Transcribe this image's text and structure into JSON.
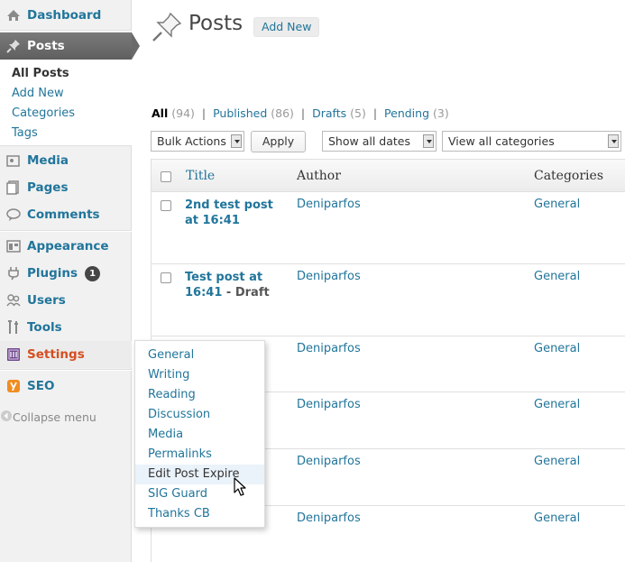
{
  "sidebar": {
    "dashboard": "Dashboard",
    "posts": "Posts",
    "posts_submenu": [
      "All Posts",
      "Add New",
      "Categories",
      "Tags"
    ],
    "media": "Media",
    "pages": "Pages",
    "comments": "Comments",
    "appearance": "Appearance",
    "plugins": "Plugins",
    "plugins_badge": "1",
    "users": "Users",
    "tools": "Tools",
    "settings": "Settings",
    "seo": "SEO",
    "collapse": "Collapse menu"
  },
  "settings_flyout": {
    "items": [
      "General",
      "Writing",
      "Reading",
      "Discussion",
      "Media",
      "Permalinks",
      "Edit Post Expire",
      "SIG Guard",
      "Thanks CB"
    ],
    "hovered": "Edit Post Expire"
  },
  "header": {
    "title": "Posts",
    "add_new": "Add New"
  },
  "filters": {
    "all_label": "All",
    "all_count": "(94)",
    "published_label": "Published",
    "published_count": "(86)",
    "drafts_label": "Drafts",
    "drafts_count": "(5)",
    "pending_label": "Pending",
    "pending_count": "(3)",
    "separator": "|"
  },
  "toolbar": {
    "bulk_actions": "Bulk Actions",
    "apply": "Apply",
    "dates": "Show all dates",
    "categories": "View all categories"
  },
  "table": {
    "columns": {
      "title": "Title",
      "author": "Author",
      "categories": "Categories"
    },
    "rows": [
      {
        "title": "2nd test post at 16:41",
        "state": "",
        "author": "Deniparfos",
        "category": "General"
      },
      {
        "title": "Test post at 16:41",
        "state": " - Draft",
        "author": "Deniparfos",
        "category": "General"
      },
      {
        "title": "",
        "state": "",
        "author": "Deniparfos",
        "category": "General"
      },
      {
        "title": "",
        "state": "",
        "author": "Deniparfos",
        "category": "General"
      },
      {
        "title": "",
        "state": "",
        "author": "Deniparfos",
        "category": "General"
      },
      {
        "title": "",
        "state": "",
        "author": "Deniparfos",
        "category": "General"
      }
    ]
  },
  "colors": {
    "link": "#21759b",
    "active_menu": "#6a6a6a",
    "settings_text": "#d54e21",
    "sidebar_bg": "#f1f1f1"
  },
  "icons": [
    "dashboard-icon",
    "pushpin-icon",
    "media-icon",
    "pages-icon",
    "comments-icon",
    "appearance-icon",
    "plugins-icon",
    "users-icon",
    "tools-icon",
    "settings-icon",
    "seo-icon",
    "collapse-icon",
    "mouse-cursor-icon"
  ]
}
